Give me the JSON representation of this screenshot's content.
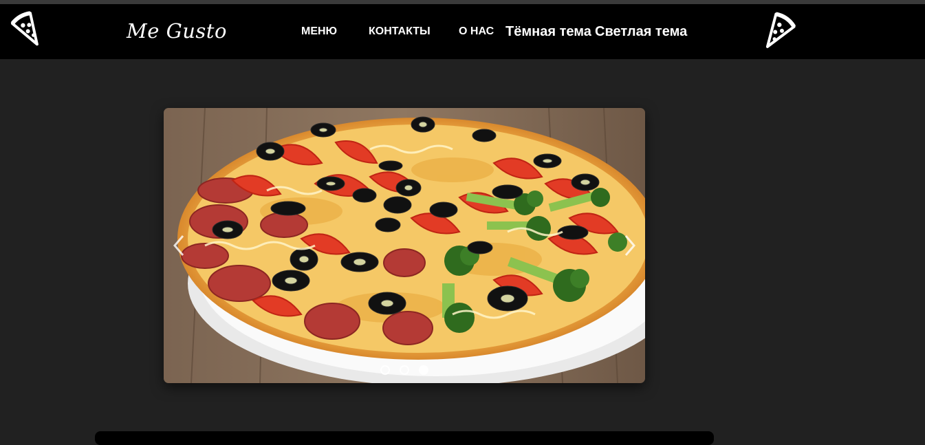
{
  "navbar": {
    "brand": "Me Gusto",
    "links": [
      "МЕНЮ",
      "КОНТАКТЫ",
      "О НАС"
    ],
    "dark_theme": "Тёмная тема",
    "light_theme": "Светлая тема",
    "left_icon": "pizza-slice-icon",
    "right_icon": "pizza-slice-icon"
  },
  "carousel": {
    "slide_image": "pizza on white plate",
    "slide_count": 3,
    "active_slide": 3
  },
  "colors": {
    "page_background": "#212121",
    "navbar_background": "#000000",
    "text": "#ffffff"
  }
}
